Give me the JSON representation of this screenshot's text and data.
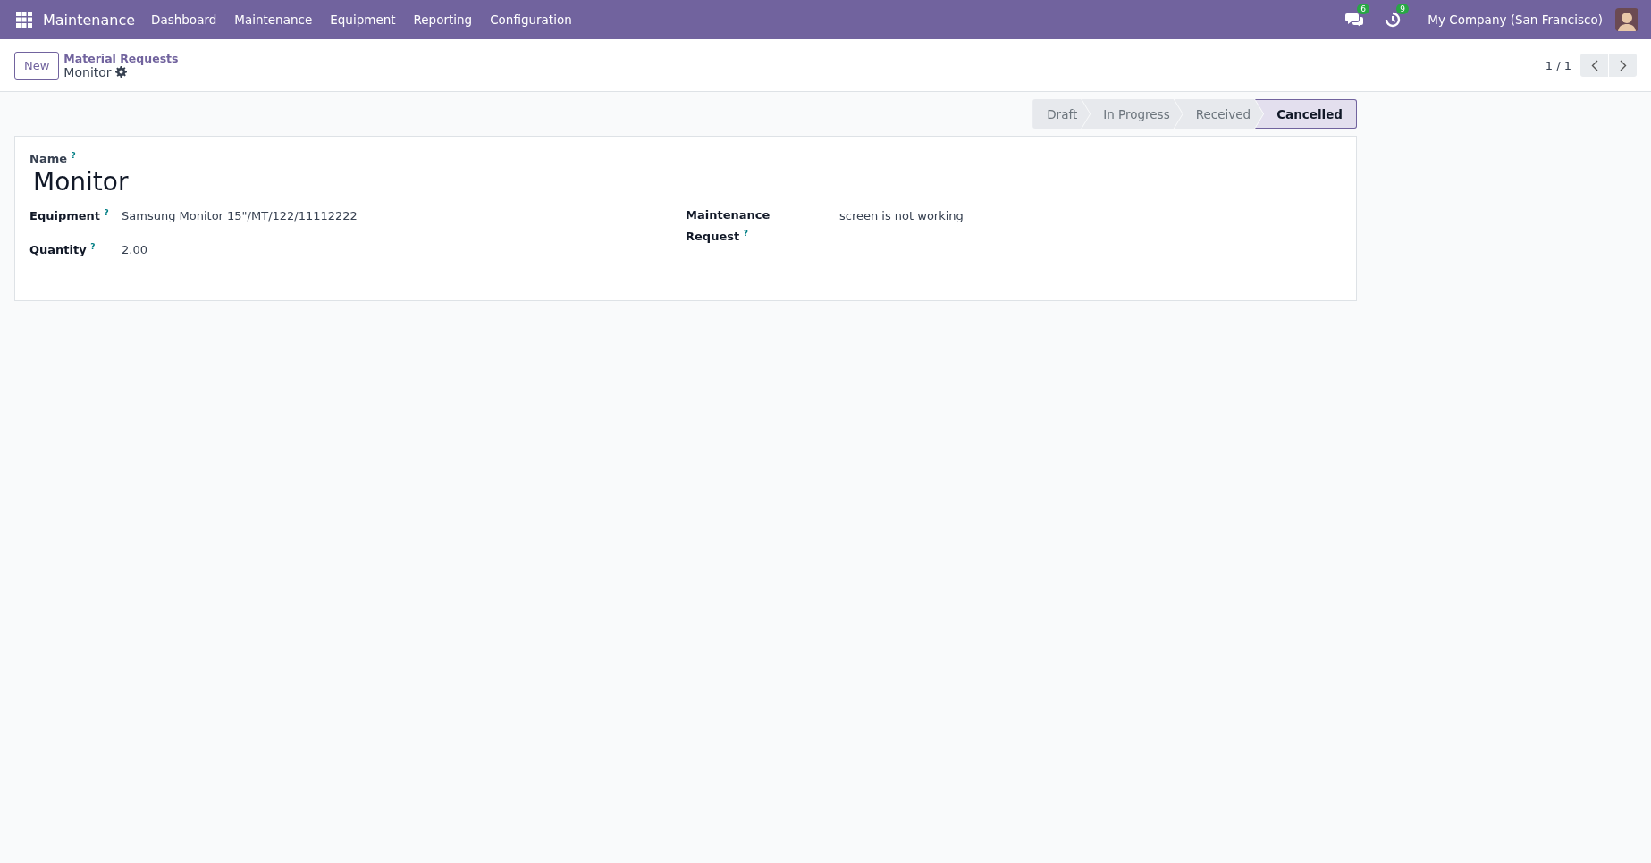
{
  "navbar": {
    "app": "Maintenance",
    "menu": [
      "Dashboard",
      "Maintenance",
      "Equipment",
      "Reporting",
      "Configuration"
    ],
    "messages_count": "6",
    "activities_count": "9",
    "company": "My Company (San Francisco)"
  },
  "control_panel": {
    "new_button": "New",
    "breadcrumb": "Material Requests",
    "record": "Monitor",
    "pager": "1 / 1"
  },
  "statusbar": [
    {
      "label": "Draft",
      "selected": false
    },
    {
      "label": "In Progress",
      "selected": false
    },
    {
      "label": "Received",
      "selected": false
    },
    {
      "label": "Cancelled",
      "selected": true
    }
  ],
  "form": {
    "name_label": "Name $^{?}$",
    "name": "Monitor",
    "left": [
      {
        "label": "Equipment $^{?}$",
        "value": "Samsung Monitor 15\"/MT/122/11112222"
      },
      {
        "label": "Quantity $^{?}$",
        "value": "2.00"
      }
    ],
    "right": [
      {
        "label": "Maintenance Request $^{?}$",
        "value": "screen is not working"
      }
    ]
  }
}
